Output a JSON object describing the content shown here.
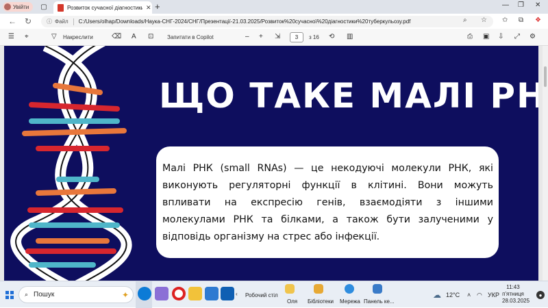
{
  "browser": {
    "profile_label": "Увійти",
    "tab_title": "Розвиток сучасної діагностики ту",
    "address_prefix": "Файл",
    "url": "C:/Users/olhap/Downloads/Наука-СНГ-2024/СНГ/Презентації-21.03.2025/Розвиток%20сучасної%20діагностики%20туберкульозу.pdf",
    "accent": "#1f6fd6"
  },
  "pdf_toolbar": {
    "draw_label": "Накреслити",
    "copilot_label": "Запитати в Copilot",
    "zoom_minus": "–",
    "zoom_plus": "+",
    "page_current": "3",
    "page_total": "з 16"
  },
  "slide": {
    "heading": "ЩО ТАКЕ МАЛІ РНК",
    "body": "Малі РНК (small RNAs) — це некодуючі молекули РНК, які виконують регуляторні функції в клітині. Вони можуть впливати на експресію генів, взаємодіяти з іншими молекулами РНК та білками, а також бути залученими у відповідь організму на стрес або інфекції.",
    "background_color": "#0e0e5e",
    "dna_colors": [
      "#d7262e",
      "#e8773b",
      "#4fb6c9",
      "#ffffff"
    ]
  },
  "taskbar": {
    "search_placeholder": "Пошук",
    "desktop_label": "Робочий стіл",
    "pinned": [
      {
        "label": "Оля",
        "icon": "folder-user-icon"
      },
      {
        "label": "Бібліотеки",
        "icon": "folder-library-icon"
      },
      {
        "label": "Мережа",
        "icon": "network-icon"
      },
      {
        "label": "Панель ке...",
        "icon": "control-panel-icon"
      }
    ],
    "weather": "12°C",
    "language": "УКР",
    "time": "11:43",
    "day": "п'ятниця",
    "date": "28.03.2025"
  }
}
